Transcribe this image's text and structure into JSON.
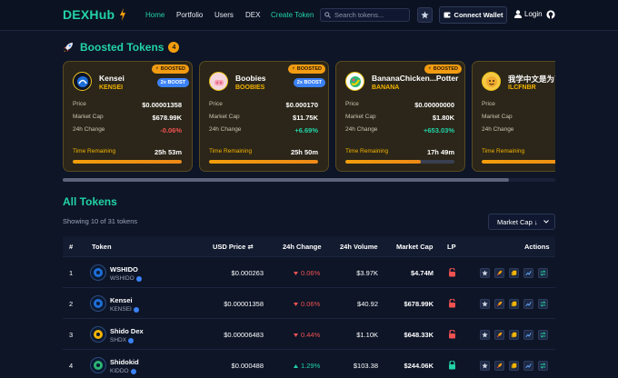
{
  "nav": {
    "logo": "DEXHub",
    "links": [
      "Home",
      "Portfolio",
      "Users",
      "DEX",
      "Create Token"
    ],
    "search_placeholder": "Search tokens...",
    "connect_label": "Connect Wallet",
    "login_label": "Login",
    "accent": "#22d3a6"
  },
  "boosted": {
    "title": "Boosted Tokens",
    "count": "4",
    "hot_label": "BOOSTED",
    "xboost_label": "2x BOOST",
    "field_labels": {
      "price": "Price",
      "market_cap": "Market Cap",
      "change": "24h Change",
      "time": "Time Remaining"
    },
    "cards": [
      {
        "name": "Kensei",
        "symbol": "KENSEI",
        "price": "$0.00001358",
        "market_cap": "$678.99K",
        "change": "-0.06%",
        "change_dir": "neg",
        "time": "25h 53m",
        "progress": 1.0,
        "xboost": true,
        "icon": "kensei-logo-icon"
      },
      {
        "name": "Boobies",
        "symbol": "BOOBIES",
        "price": "$0.000170",
        "market_cap": "$11.75K",
        "change": "+6.69%",
        "change_dir": "pos",
        "time": "25h 50m",
        "progress": 1.0,
        "xboost": true,
        "icon": "boobies-logo-icon"
      },
      {
        "name": "BananaChicken...Potter",
        "symbol": "BANANA",
        "price": "$0.00000000",
        "market_cap": "$1.80K",
        "change": "+653.03%",
        "change_dir": "pos",
        "time": "17h 49m",
        "progress": 0.69,
        "xboost": false,
        "icon": "banana-logo-icon"
      },
      {
        "name": "我学中文是为了",
        "symbol": "ILCFNBR",
        "price": "",
        "market_cap": "",
        "change": "",
        "change_dir": "",
        "time": "",
        "progress": 1.0,
        "xboost": false,
        "icon": "ilcfnbr-logo-icon"
      }
    ]
  },
  "all_tokens": {
    "title": "All Tokens",
    "showing": "Showing 10 of 31 tokens",
    "sort_label": "Market Cap ↓",
    "headers": [
      "#",
      "Token",
      "USD Price ⇄",
      "24h Change",
      "24h Volume",
      "Market Cap",
      "LP",
      "Actions"
    ],
    "rows": [
      {
        "rank": "1",
        "name": "WSHIDO",
        "symbol": "WSHIDO",
        "price": "$0.000263",
        "change": "0.06%",
        "change_dir": "neg",
        "volume": "$3.97K",
        "mcap": "$4.74M",
        "lp_locked": false,
        "icon": "wshido-logo-icon"
      },
      {
        "rank": "2",
        "name": "Kensei",
        "symbol": "KENSEI",
        "price": "$0.00001358",
        "change": "0.06%",
        "change_dir": "neg",
        "volume": "$40.92",
        "mcap": "$678.99K",
        "lp_locked": false,
        "icon": "kensei-logo-icon"
      },
      {
        "rank": "3",
        "name": "Shido Dex",
        "symbol": "SHDX",
        "price": "$0.00006483",
        "change": "0.44%",
        "change_dir": "neg",
        "volume": "$1.10K",
        "mcap": "$648.33K",
        "lp_locked": false,
        "icon": "shido-dex-logo-icon"
      },
      {
        "rank": "4",
        "name": "Shidokid",
        "symbol": "KIDDO",
        "price": "$0.000488",
        "change": "1.29%",
        "change_dir": "pos",
        "volume": "$103.38",
        "mcap": "$244.06K",
        "lp_locked": true,
        "icon": "shidokid-logo-icon"
      }
    ]
  }
}
